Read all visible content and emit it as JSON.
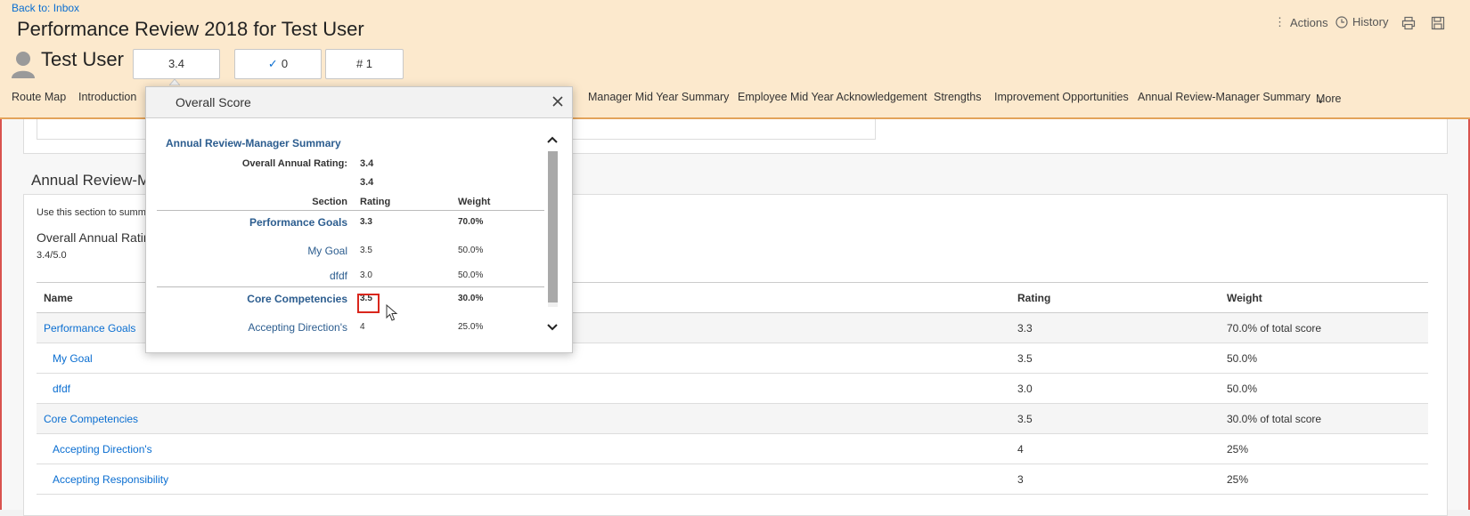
{
  "header": {
    "back_link": "Back to: Inbox",
    "title": "Performance Review 2018 for Test User",
    "user_name": "Test User",
    "score_boxes": [
      "3.4",
      "0",
      "# 1"
    ],
    "actions": [
      "Actions",
      "History"
    ],
    "nav": [
      "Route Map",
      "Introduction",
      "Manager Mid Year Summary",
      "Employee Mid Year Acknowledgement",
      "Strengths",
      "Improvement Opportunities",
      "Annual Review-Manager Summary",
      "More"
    ]
  },
  "popover": {
    "title": "Overall Score",
    "section_title": "Annual Review-Manager Summary",
    "overall_label": "Overall Annual Rating:",
    "overall_value": "3.4",
    "overall_value2": "3.4",
    "columns": [
      "Section",
      "Rating",
      "Weight"
    ],
    "rows": [
      {
        "name": "Performance Goals",
        "rating": "3.3",
        "weight": "70.0%"
      },
      {
        "name": "My Goal",
        "rating": "3.5",
        "weight": "50.0%"
      },
      {
        "name": "dfdf",
        "rating": "3.0",
        "weight": "50.0%"
      },
      {
        "name": "Core Competencies",
        "rating": "3.5",
        "weight": "30.0%"
      },
      {
        "name": "Accepting Direction's",
        "rating": "4",
        "weight": "25.0%"
      }
    ]
  },
  "main": {
    "section_title": "Annual Review-Ma",
    "description": "Use this section to summ",
    "overall_label": "Overall Annual Ratin",
    "overall_value": "3.4/5.0",
    "table": {
      "columns": [
        "Name",
        "Rating",
        "Weight"
      ],
      "rows": [
        {
          "name": "Performance Goals",
          "rating": "3.3",
          "weight": "70.0% of total score"
        },
        {
          "name": "My Goal",
          "rating": "3.5",
          "weight": "50.0%"
        },
        {
          "name": "dfdf",
          "rating": "3.0",
          "weight": "50.0%"
        },
        {
          "name": "Core Competencies",
          "rating": "3.5",
          "weight": "30.0% of total score"
        },
        {
          "name": "Accepting Direction's",
          "rating": "4",
          "weight": "25%"
        },
        {
          "name": "Accepting Responsibility",
          "rating": "3",
          "weight": "25%"
        }
      ]
    }
  },
  "colors": {
    "header_bg": "#fce9cd",
    "link": "#0a6ed1",
    "highlight": "#d9261c"
  }
}
